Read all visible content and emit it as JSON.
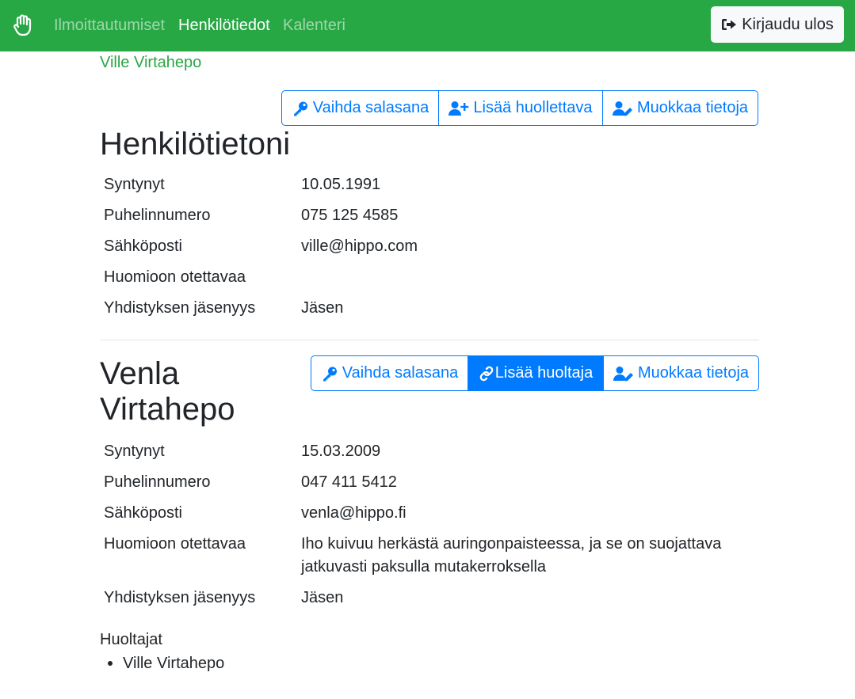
{
  "nav": {
    "brand_icon": "hand-paper-icon",
    "links": [
      "Ilmoittautumiset",
      "Henkilötiedot",
      "Kalenteri"
    ],
    "active": "Henkilötiedot",
    "logout_label": "Kirjaudu ulos",
    "logout_icon": "sign-out-icon"
  },
  "user_link": "Ville Virtahepo",
  "colors": {
    "navbar": "#28a745",
    "primary": "#007bff",
    "user_link": "#28a745"
  },
  "self": {
    "title": "Henkilötietoni",
    "buttons": [
      {
        "label": "Vaihda salasana",
        "icon": "key-icon"
      },
      {
        "label": "Lisää huollettava",
        "icon": "user-plus-icon"
      },
      {
        "label": "Muokkaa tietoja",
        "icon": "user-edit-icon"
      }
    ],
    "rows": [
      {
        "label": "Syntynyt",
        "value": "10.05.1991"
      },
      {
        "label": "Puhelinnumero",
        "value": "075 125 4585"
      },
      {
        "label": "Sähköposti",
        "value": "ville@hippo.com"
      },
      {
        "label": "Huomioon otettavaa",
        "value": ""
      },
      {
        "label": "Yhdistyksen jäsenyys",
        "value": "Jäsen"
      }
    ]
  },
  "child": {
    "title_line1": "Venla",
    "title_line2": "Virtahepo",
    "buttons": [
      {
        "label": "Vaihda salasana",
        "icon": "key-icon"
      },
      {
        "label": "Lisää huoltaja",
        "icon": "link-icon"
      },
      {
        "label": "Muokkaa tietoja",
        "icon": "user-edit-icon"
      }
    ],
    "rows": [
      {
        "label": "Syntynyt",
        "value": "15.03.2009"
      },
      {
        "label": "Puhelinnumero",
        "value": "047 411 5412"
      },
      {
        "label": "Sähköposti",
        "value": "venla@hippo.fi"
      },
      {
        "label": "Huomioon otettavaa",
        "value": "Iho kuivuu herkästä auringonpaisteessa, ja se on suojattava jatkuvasti paksulla mutakerroksella"
      },
      {
        "label": "Yhdistyksen jäsenyys",
        "value": "Jäsen"
      }
    ],
    "guardians_title": "Huoltajat",
    "guardians": [
      "Ville Virtahepo"
    ]
  }
}
